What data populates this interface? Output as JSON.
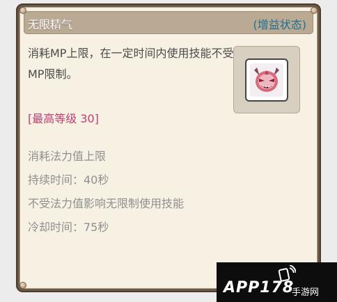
{
  "tooltip": {
    "title": "无限精气",
    "status": "(增益状态)",
    "description": "消耗MP上限，在一定时间内使用技能不受MP限制。",
    "level": "[最高等级 30]",
    "stats": [
      "消耗法力值上限",
      "持续时间：40秒",
      "不受法力值影响无限制使用技能",
      "冷却时间：75秒"
    ],
    "icon": "demon-face-icon"
  },
  "watermark": {
    "main": "APP178",
    "sub": "手游网"
  },
  "colors": {
    "frame": "#6b5a48",
    "panel": "#f6f1e2",
    "titlebar": "#baa993",
    "status": "#1f6f8f",
    "level": "#c13c73",
    "stats": "#8f8f8f"
  }
}
